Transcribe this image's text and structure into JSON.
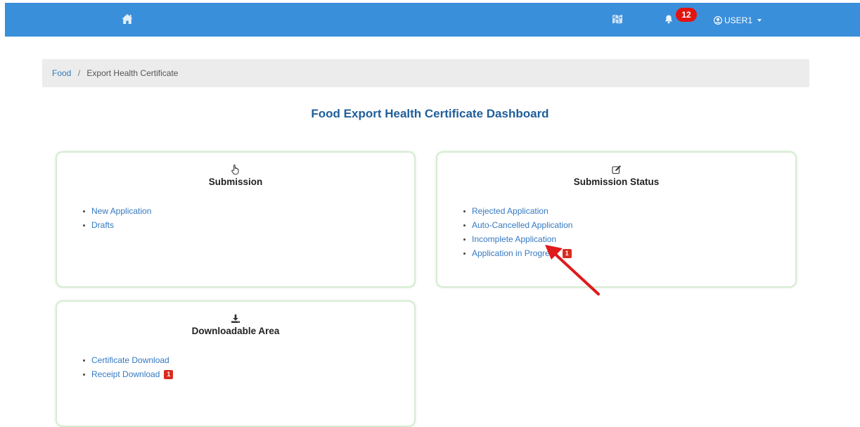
{
  "nav": {
    "notification_count": "12",
    "user_label": "USER1"
  },
  "breadcrumb": {
    "root": "Food",
    "separator": "/",
    "current": "Export Health Certificate"
  },
  "page_title": "Food Export Health Certificate Dashboard",
  "cards": {
    "submission": {
      "title": "Submission",
      "icon": "hand-pointer-icon",
      "items": [
        {
          "label": "New Application"
        },
        {
          "label": "Drafts"
        }
      ]
    },
    "status": {
      "title": "Submission Status",
      "icon": "edit-icon",
      "items": [
        {
          "label": "Rejected Application"
        },
        {
          "label": "Auto-Cancelled Application"
        },
        {
          "label": "Incomplete Application"
        },
        {
          "label": "Application in Progress",
          "badge": "1"
        }
      ]
    },
    "download": {
      "title": "Downloadable Area",
      "icon": "download-icon",
      "items": [
        {
          "label": "Certificate Download"
        },
        {
          "label": "Receipt Download",
          "badge": "1"
        }
      ]
    }
  },
  "colors": {
    "navbar": "#3a8fdb",
    "title": "#1f5e9b",
    "link": "#3579c2",
    "badge": "#e3140f",
    "annotation_arrow": "#e0191b"
  }
}
